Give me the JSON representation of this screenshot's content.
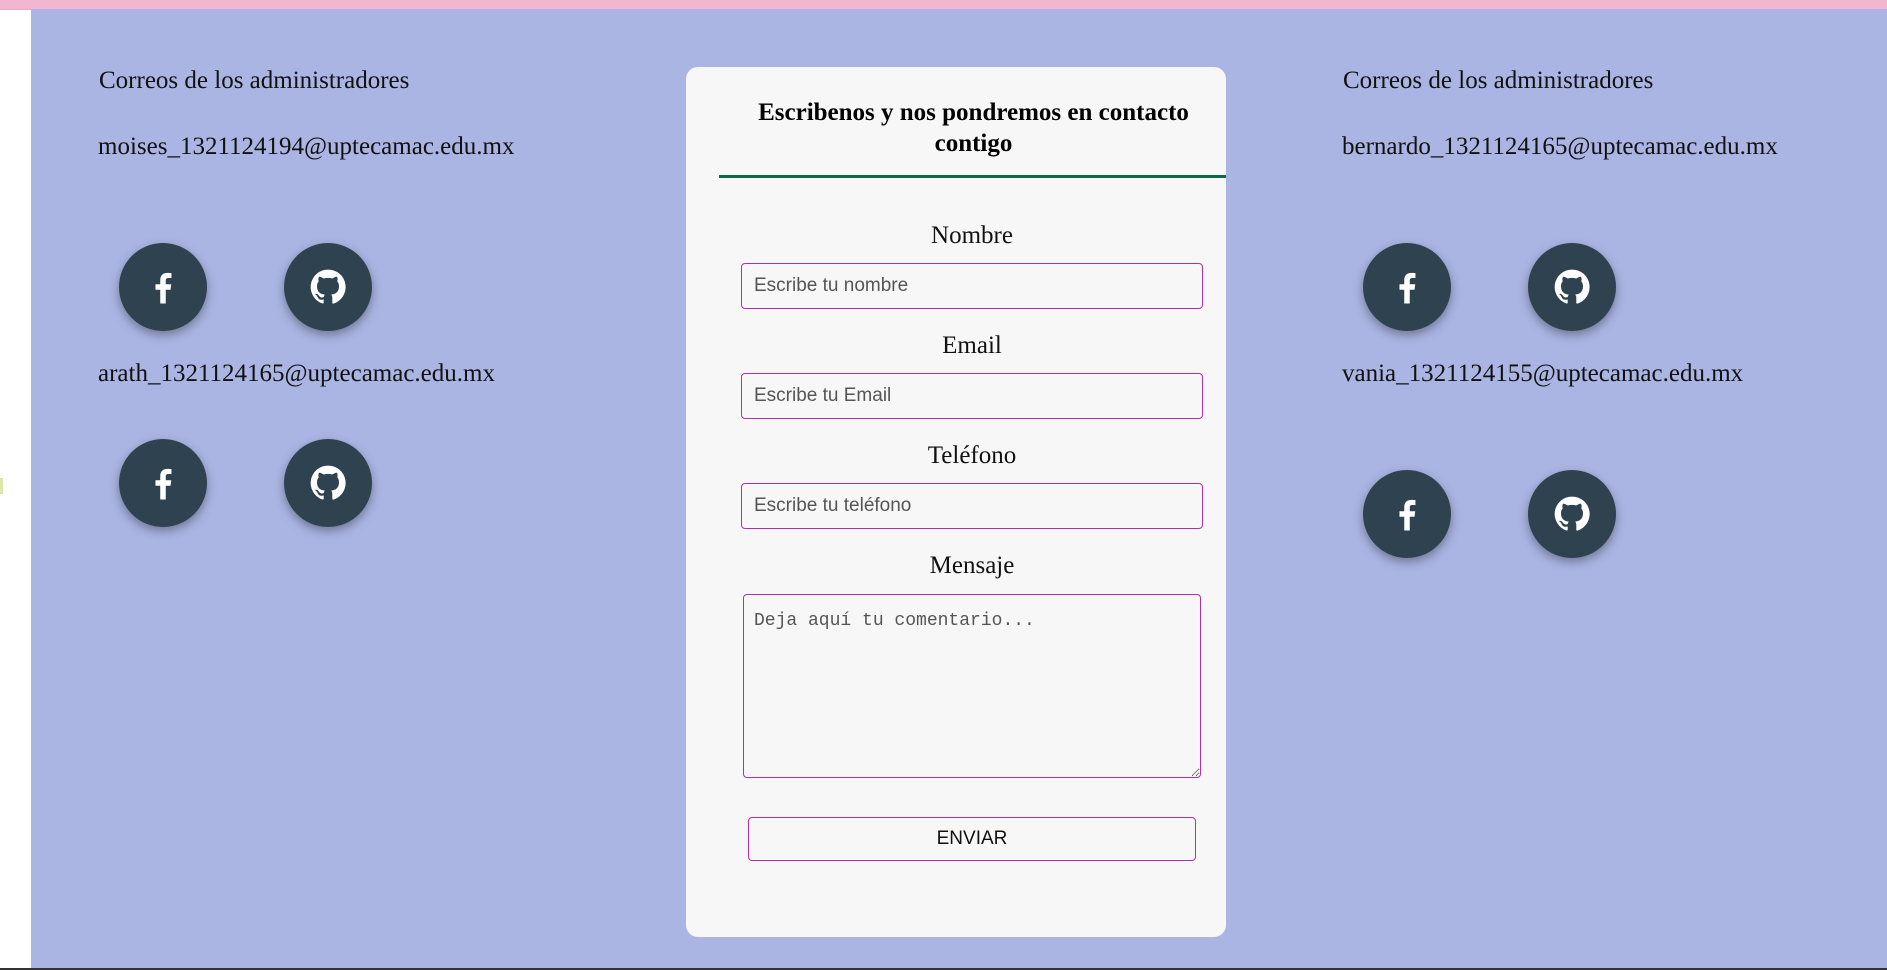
{
  "left_panel": {
    "title": "Correos de los administradores",
    "admins": [
      {
        "email": "moises_1321124194@uptecamac.edu.mx",
        "social": [
          "facebook-icon",
          "github-icon"
        ]
      },
      {
        "email": "arath_1321124165@uptecamac.edu.mx",
        "social": [
          "facebook-icon",
          "github-icon"
        ]
      }
    ]
  },
  "right_panel": {
    "title": "Correos de los administradores",
    "admins": [
      {
        "email": "bernardo_1321124165@uptecamac.edu.mx",
        "social": [
          "facebook-icon",
          "github-icon"
        ]
      },
      {
        "email": "vania_1321124155@uptecamac.edu.mx",
        "social": [
          "facebook-icon",
          "github-icon"
        ]
      }
    ]
  },
  "form": {
    "title": "Escribenos y nos pondremos en contacto contigo",
    "fields": {
      "name": {
        "label": "Nombre",
        "placeholder": "Escribe tu nombre",
        "value": ""
      },
      "email": {
        "label": "Email",
        "placeholder": "Escribe tu Email",
        "value": ""
      },
      "phone": {
        "label": "Teléfono",
        "placeholder": "Escribe tu teléfono",
        "value": ""
      },
      "message": {
        "label": "Mensaje",
        "placeholder": "Deja aquí tu comentario...",
        "value": ""
      }
    },
    "submit_label": "ENVIAR"
  },
  "colors": {
    "page_background": "#aab5e3",
    "top_strip": "#f3b6d0",
    "card_background": "#f8f7f8",
    "input_border": "#b52cb0",
    "title_rule": "#0b6b45",
    "social_button": "#2f4250"
  }
}
